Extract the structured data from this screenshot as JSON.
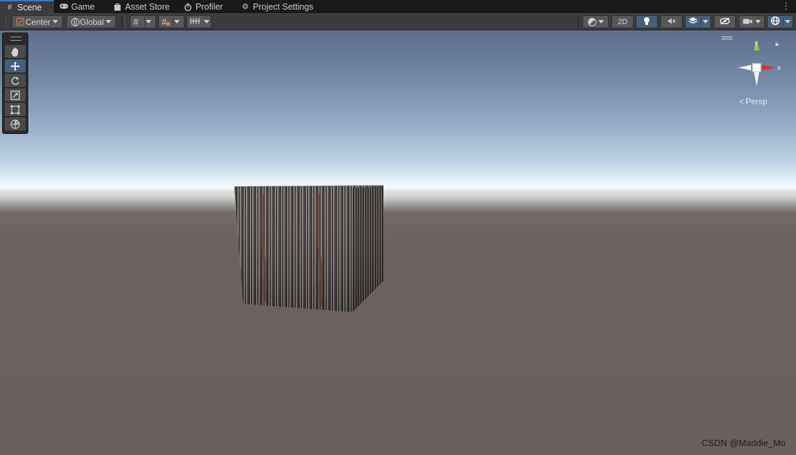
{
  "tabs": [
    {
      "label": "Scene",
      "icon": "grid-hash-icon",
      "active": true
    },
    {
      "label": "Game",
      "icon": "gamepad-icon",
      "active": false
    },
    {
      "label": "Asset Store",
      "icon": "shopping-bag-icon",
      "active": false
    },
    {
      "label": "Profiler",
      "icon": "stopwatch-icon",
      "active": false
    },
    {
      "label": "Project Settings",
      "icon": "gear-icon",
      "active": false
    }
  ],
  "toolbar": {
    "pivot_mode": "Center",
    "pivot_rotation": "Global",
    "mode_2d": "2D"
  },
  "tools": [
    {
      "name": "hand-tool",
      "icon": "hand-icon",
      "selected": false
    },
    {
      "name": "move-tool",
      "icon": "move-arrows-icon",
      "selected": true
    },
    {
      "name": "rotate-tool",
      "icon": "rotate-icon",
      "selected": false
    },
    {
      "name": "scale-tool",
      "icon": "scale-icon",
      "selected": false
    },
    {
      "name": "rect-tool",
      "icon": "rect-transform-icon",
      "selected": false
    },
    {
      "name": "transform-tool",
      "icon": "transform-icon",
      "selected": false
    }
  ],
  "gizmo": {
    "axis_y": "y",
    "axis_x": "x",
    "projection": "Persp",
    "colors": {
      "x": "#e0322c",
      "y": "#8ecc3a",
      "z": "#ffffff"
    }
  },
  "watermark": "CSDN @Maddie_Mo",
  "colors": {
    "accent": "#3a79bb",
    "selected_button": "#46607c",
    "toolbar_bg": "#3c3c3c"
  }
}
